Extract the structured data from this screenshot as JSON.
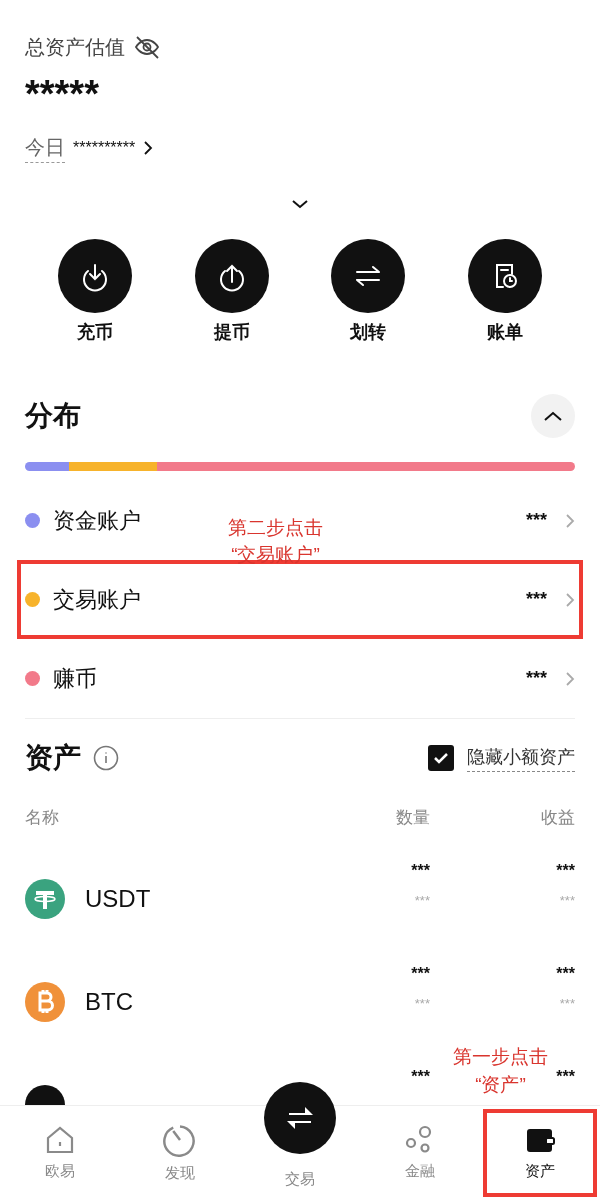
{
  "header": {
    "title": "总资产估值",
    "balance": "*****",
    "today_label": "今日",
    "today_value": "**********"
  },
  "actions": [
    {
      "label": "充币",
      "kind": "deposit"
    },
    {
      "label": "提币",
      "kind": "withdraw"
    },
    {
      "label": "划转",
      "kind": "transfer"
    },
    {
      "label": "账单",
      "kind": "bill"
    }
  ],
  "distribution": {
    "title": "分布",
    "expanded": true,
    "accounts": [
      {
        "name": "资金账户",
        "value": "***",
        "color": "#8b8ff0",
        "level": 0.08,
        "highlighted": false
      },
      {
        "name": "交易账户",
        "value": "***",
        "color": "#f7b32b",
        "level": 0.16,
        "highlighted": true
      },
      {
        "name": "赚币",
        "value": "***",
        "color": "#f27a8a",
        "level": 0.76,
        "highlighted": false
      }
    ]
  },
  "assets": {
    "title": "资产",
    "hide_small": {
      "label": "隐藏小额资产",
      "checked": true
    },
    "columns": [
      "名称",
      "数量",
      "收益"
    ],
    "rows": [
      {
        "name": "USDT",
        "kind": "usdt",
        "amount": "***",
        "amount_sub": "***",
        "pnl": "***",
        "pnl_sub": "***"
      },
      {
        "name": "BTC",
        "kind": "btc",
        "amount": "***",
        "amount_sub": "***",
        "pnl": "***",
        "pnl_sub": "***"
      },
      {
        "kind": "dark",
        "amount": "***",
        "pnl": "***"
      }
    ]
  },
  "nav": [
    {
      "label": "欧易",
      "kind": "home",
      "selected": false,
      "highlighted": false
    },
    {
      "label": "发现",
      "kind": "discover",
      "selected": false,
      "highlighted": false
    },
    {
      "label": "交易",
      "kind": "trade",
      "selected": false,
      "highlighted": false
    },
    {
      "label": "金融",
      "kind": "finance",
      "selected": false,
      "highlighted": false
    },
    {
      "label": "资产",
      "kind": "wallet",
      "selected": true,
      "highlighted": true
    }
  ],
  "annotations": [
    {
      "kind": "account",
      "lines": [
        "第二步点击",
        "“交易账户”"
      ]
    },
    {
      "kind": "nav",
      "lines": [
        "第一步点击",
        "“资产”"
      ]
    }
  ]
}
